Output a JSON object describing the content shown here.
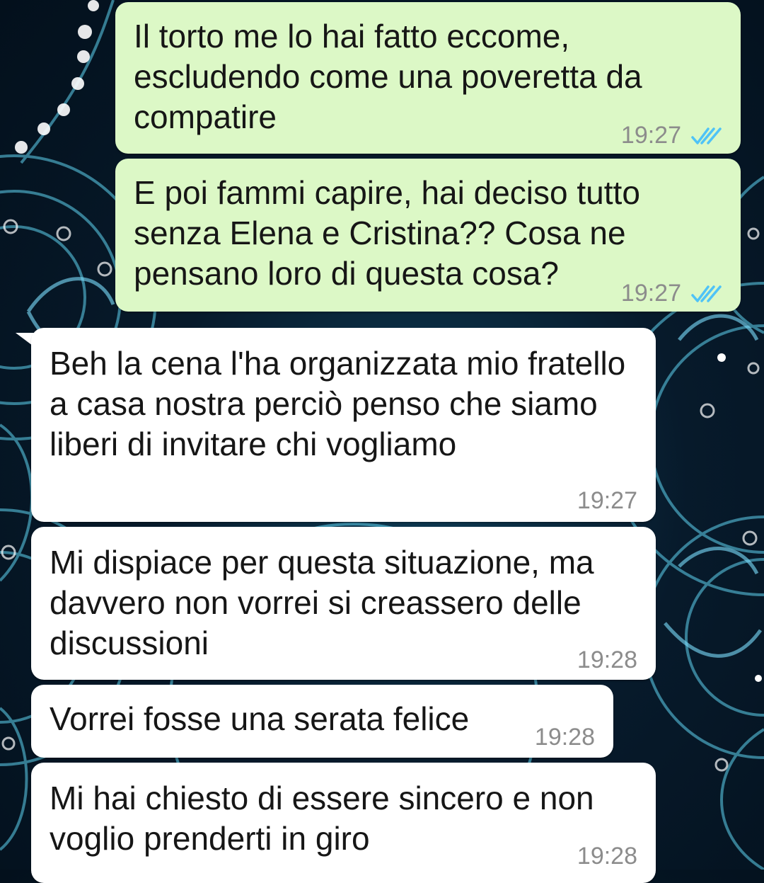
{
  "theme": {
    "outgoing_bubble": "#dcf8c6",
    "incoming_bubble": "#ffffff",
    "read_ticks": "#4fc3f7",
    "timestamp": "#8c8c8c",
    "wallpaper": "#071a2b",
    "pattern": "#5fd3f0"
  },
  "messages": [
    {
      "direction": "outgoing",
      "text": "Il torto me lo hai fatto eccome, escludendo come una poveretta da compatire",
      "time": "19:27",
      "status_icon": "double-check-read-icon"
    },
    {
      "direction": "outgoing",
      "text": "E poi fammi capire, hai deciso tutto senza Elena e Cristina?? Cosa ne pensano loro di questa cosa?",
      "time": "19:27",
      "status_icon": "double-check-read-icon"
    },
    {
      "direction": "incoming",
      "text": "Beh la cena l'ha organizzata mio fratello a casa nostra perciò penso che siamo liberi di invitare chi vogliamo",
      "time": "19:27"
    },
    {
      "direction": "incoming",
      "text": "Mi dispiace per questa situazione, ma davvero non vorrei si creassero delle discussioni",
      "time": "19:28"
    },
    {
      "direction": "incoming",
      "text": "Vorrei fosse una serata felice",
      "time": "19:28"
    },
    {
      "direction": "incoming",
      "text": "Mi hai chiesto di essere sincero e non voglio prenderti in giro",
      "time": "19:28"
    }
  ]
}
